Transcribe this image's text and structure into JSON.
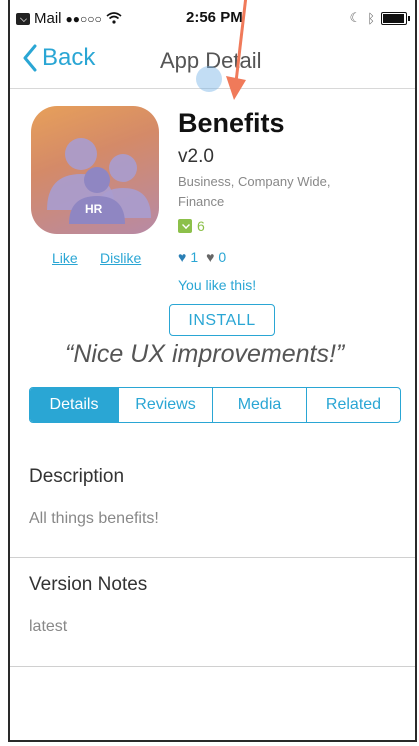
{
  "status_bar": {
    "carrier": "Mail",
    "signal": "●●○○○",
    "time": "2:56 PM"
  },
  "nav": {
    "back_label": "Back",
    "title": "App Detail"
  },
  "app": {
    "icon_text": "HR",
    "name": "Benefits",
    "version": "v2.0",
    "categories": "Business, Company Wide, Finance",
    "downloads": "6",
    "like_label": "Like",
    "dislike_label": "Dislike",
    "likes": "1",
    "dislikes": "0",
    "you_like": "You like this!",
    "install_label": "INSTALL",
    "quote": "“Nice UX improvements!”"
  },
  "tabs": [
    {
      "label": "Details",
      "active": true
    },
    {
      "label": "Reviews",
      "active": false
    },
    {
      "label": "Media",
      "active": false
    },
    {
      "label": "Related",
      "active": false
    }
  ],
  "description": {
    "title": "Description",
    "body": "All things benefits!"
  },
  "version_notes": {
    "title": "Version Notes",
    "body": "latest"
  },
  "colors": {
    "accent": "#2aa6d4",
    "downloads_green": "#8cc04a",
    "arrow": "#f07a5a"
  }
}
